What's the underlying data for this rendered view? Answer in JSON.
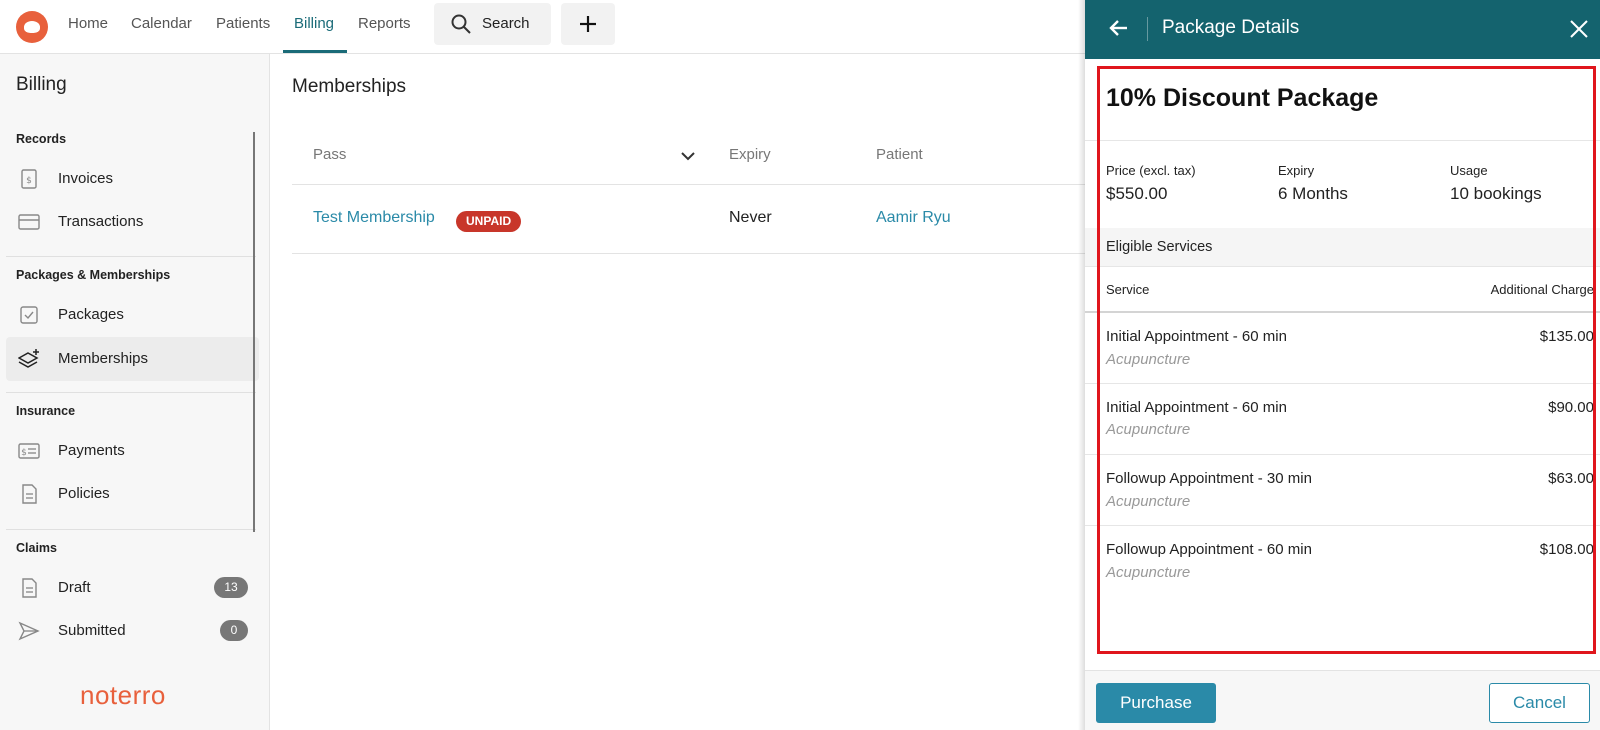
{
  "nav": {
    "items": [
      {
        "label": "Home"
      },
      {
        "label": "Calendar"
      },
      {
        "label": "Patients"
      },
      {
        "label": "Billing"
      },
      {
        "label": "Reports"
      }
    ],
    "search_label": "Search"
  },
  "sidebar": {
    "title": "Billing",
    "sections": {
      "records": "Records",
      "packages": "Packages & Memberships",
      "insurance": "Insurance",
      "claims": "Claims"
    },
    "items": {
      "invoices": "Invoices",
      "transactions": "Transactions",
      "packages": "Packages",
      "memberships": "Memberships",
      "payments": "Payments",
      "policies": "Policies",
      "draft": "Draft",
      "submitted": "Submitted"
    },
    "badges": {
      "draft": "13",
      "submitted": "0"
    },
    "brand": "noterro"
  },
  "main": {
    "title": "Memberships",
    "columns": {
      "pass": "Pass",
      "expiry": "Expiry",
      "patient": "Patient"
    },
    "rows": [
      {
        "pass": "Test Membership",
        "status": "UNPAID",
        "expiry": "Never",
        "patient": "Aamir Ryu"
      }
    ]
  },
  "panel": {
    "header_title": "Package Details",
    "package_title": "10% Discount Package",
    "meta": {
      "price_label": "Price (excl. tax)",
      "price_value": "$550.00",
      "expiry_label": "Expiry",
      "expiry_value": "6 Months",
      "usage_label": "Usage",
      "usage_value": "10 bookings"
    },
    "eligible_label": "Eligible Services",
    "services_header": {
      "service": "Service",
      "charge": "Additional Charge"
    },
    "services": [
      {
        "name": "Initial Appointment - 60 min",
        "category": "Acupuncture",
        "charge": "$135.00"
      },
      {
        "name": "Initial Appointment - 60 min",
        "category": "Acupuncture",
        "charge": "$90.00"
      },
      {
        "name": "Followup Appointment - 30 min",
        "category": "Acupuncture",
        "charge": "$63.00"
      },
      {
        "name": "Followup Appointment - 60 min",
        "category": "Acupuncture",
        "charge": "$108.00"
      }
    ],
    "purchase_label": "Purchase",
    "cancel_label": "Cancel"
  },
  "colors": {
    "accent": "#14636e",
    "link": "#2a8aa8",
    "brand": "#e8603c",
    "danger": "#c8362a",
    "highlight": "#e0161d"
  }
}
